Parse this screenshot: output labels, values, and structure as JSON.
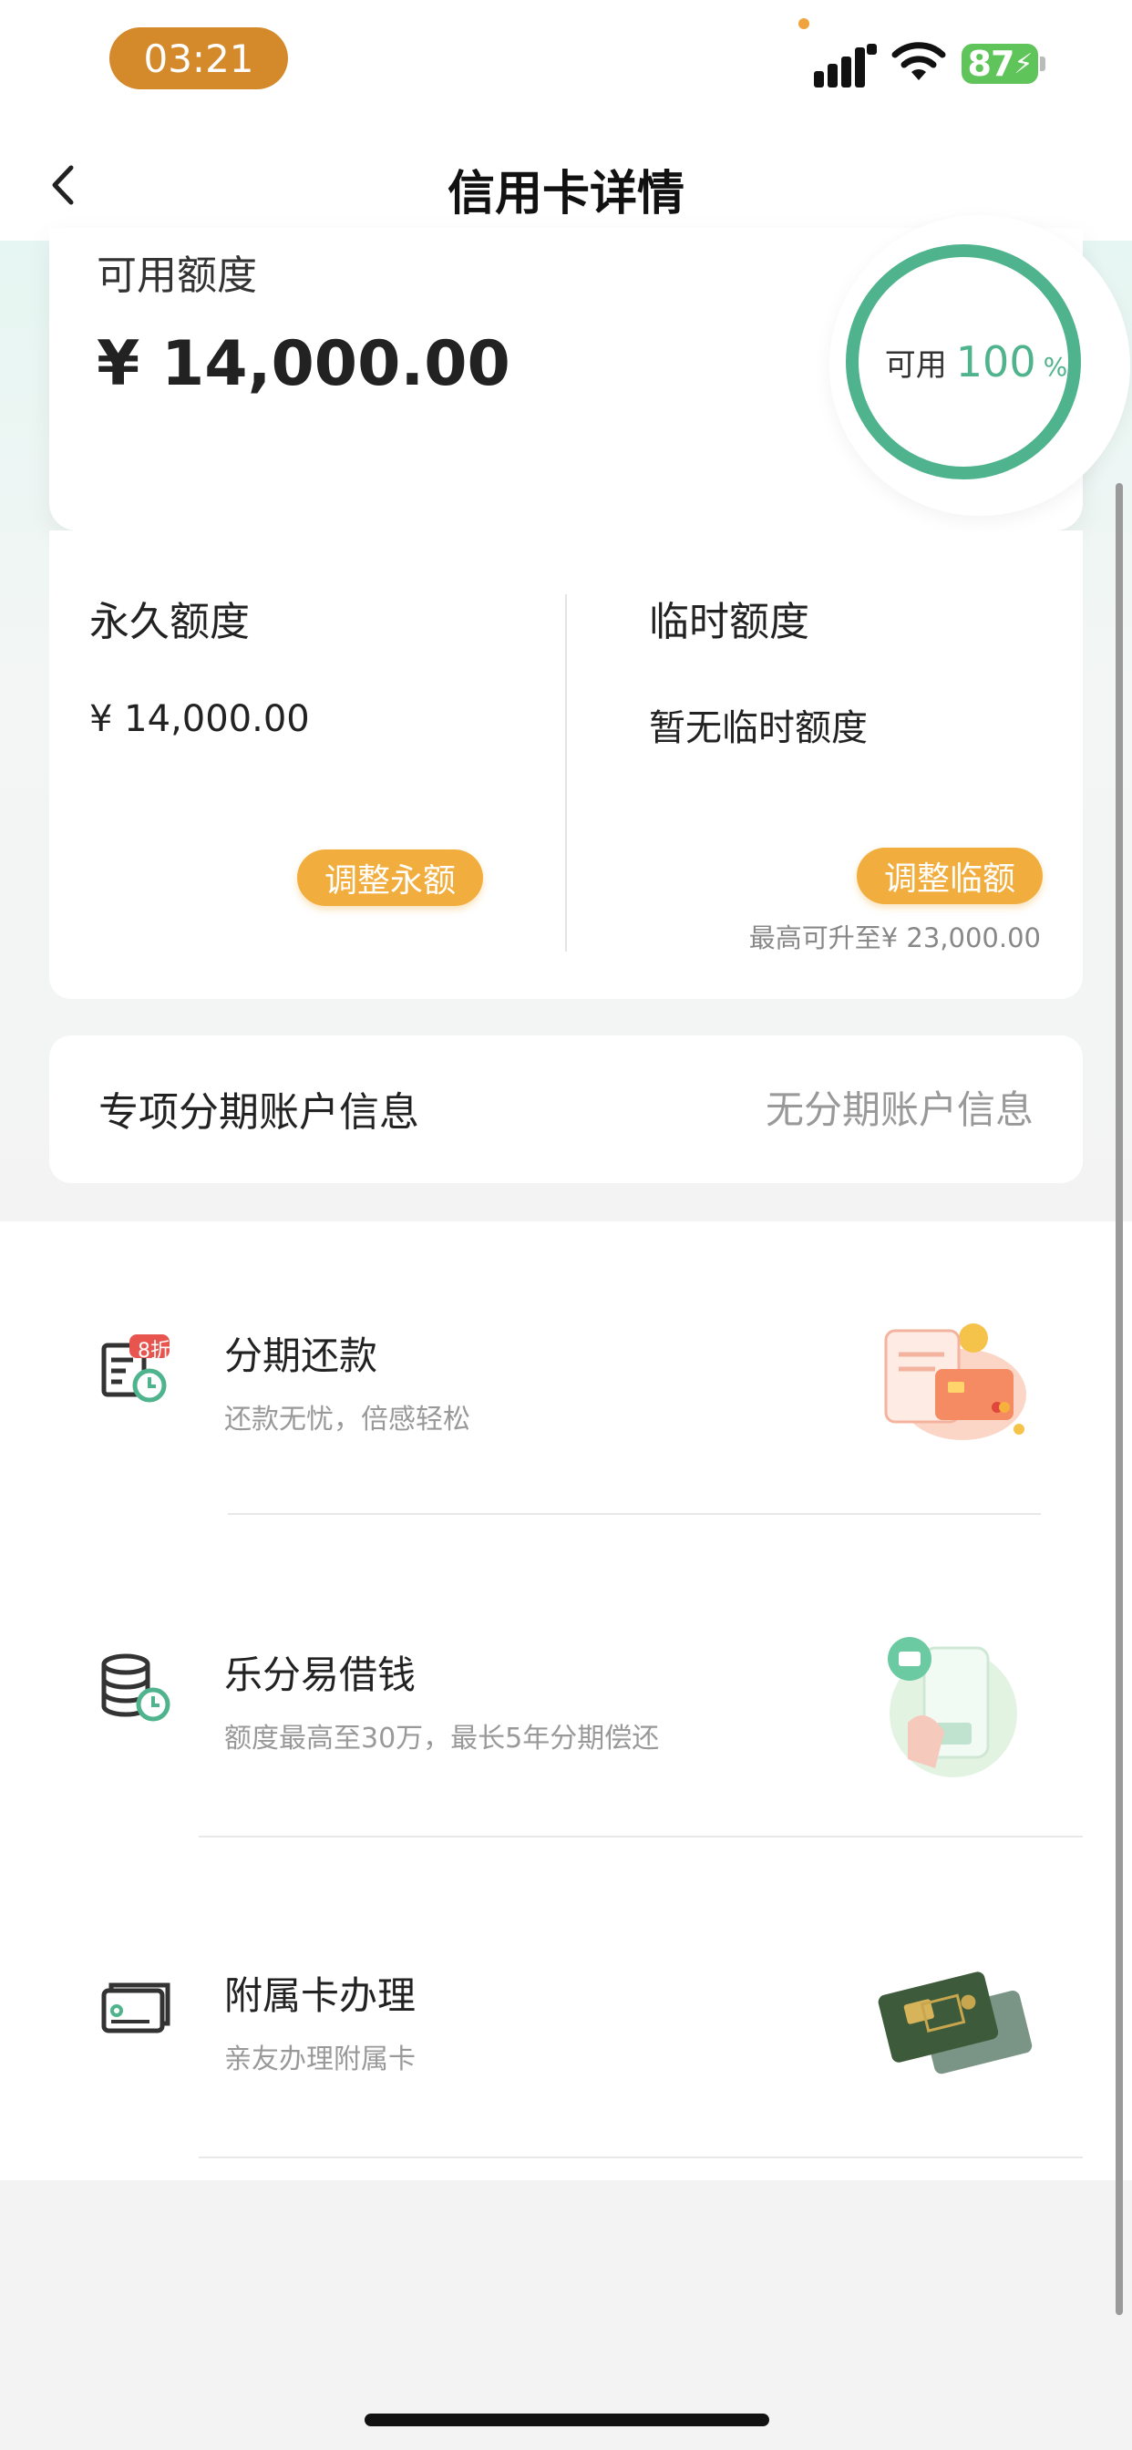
{
  "status_bar": {
    "time": "03:21",
    "battery": "87"
  },
  "nav": {
    "title": "信用卡详情"
  },
  "available": {
    "label": "可用额度",
    "amount": "¥ 14,000.00",
    "ring_label": "可用",
    "ring_percent": "100",
    "ring_percent_sign": "%",
    "ring_fraction": 1.0
  },
  "limits": {
    "permanent": {
      "title": "永久额度",
      "value": "¥ 14,000.00",
      "button": "调整永额"
    },
    "temporary": {
      "title": "临时额度",
      "value": "暂无临时额度",
      "button": "调整临额",
      "note": "最高可升至¥ 23,000.00"
    }
  },
  "installment_account": {
    "label": "专项分期账户信息",
    "value": "无分期账户信息"
  },
  "services": [
    {
      "title": "分期还款",
      "subtitle": "还款无忧，倍感轻松",
      "badge": "8折",
      "icon": "installment-repay-icon"
    },
    {
      "title": "乐分易借钱",
      "subtitle": "额度最高至30万，最长5年分期偿还",
      "icon": "coins-clock-icon"
    },
    {
      "title": "附属卡办理",
      "subtitle": "亲友办理附属卡",
      "icon": "card-icon"
    }
  ],
  "colors": {
    "accent_green": "#4fb48d",
    "accent_orange": "#f1ae3e",
    "time_pill": "#d48a2a",
    "battery": "#5fc45a"
  }
}
